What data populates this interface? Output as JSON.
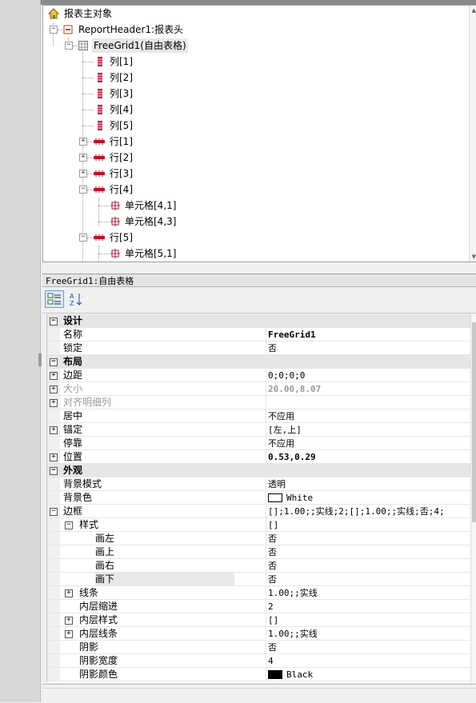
{
  "tree": {
    "root_label": "报表主对象",
    "header_label": "ReportHeader1:报表头",
    "grid_label": "FreeGrid1(自由表格)",
    "columns": [
      "列[1]",
      "列[2]",
      "列[3]",
      "列[4]",
      "列[5]"
    ],
    "rows_collapsed": [
      "行[1]",
      "行[2]",
      "行[3]"
    ],
    "row4_label": "行[4]",
    "row4_cells": [
      "单元格[4,1]",
      "单元格[4,3]"
    ],
    "row5_label": "行[5]",
    "row5_cells": [
      "单元格[5,1]"
    ]
  },
  "props": {
    "object_title": "FreeGrid1:自由表格",
    "toolbar": {
      "categorized_icon": "categorized-icon",
      "alpha_icon": "alphabetical-sort-icon"
    },
    "categories": {
      "design": "设计",
      "layout": "布局",
      "appearance": "外观"
    },
    "rows": {
      "name_label": "名称",
      "name_value": "FreeGrid1",
      "locked_label": "锁定",
      "locked_value": "否",
      "margin_label": "边距",
      "margin_value": "0;0;0;0",
      "size_label": "大小",
      "size_value": "20.00,8.07",
      "align_label": "对齐明细列",
      "align_value": "",
      "center_label": "居中",
      "center_value": "不应用",
      "anchor_label": "锚定",
      "anchor_value": "[左,上]",
      "dock_label": "停靠",
      "dock_value": "不应用",
      "position_label": "位置",
      "position_value": "0.53,0.29",
      "bgmode_label": "背景模式",
      "bgmode_value": "透明",
      "bgcolor_label": "背景色",
      "bgcolor_value": "White",
      "border_label": "边框",
      "border_value": "[];1.00;;实线;2;[];1.00;;实线;否;4;",
      "style_label": "样式",
      "style_value": "[]",
      "left_label": "画左",
      "left_value": "否",
      "top_label": "画上",
      "top_value": "否",
      "right_label": "画右",
      "right_value": "否",
      "bottom_label": "画下",
      "bottom_value": "否",
      "line_label": "线条",
      "line_value": "1.00;;实线",
      "indent_label": "内层缩进",
      "indent_value": "2",
      "innerstyle_label": "内层样式",
      "innerstyle_value": "[]",
      "innerline_label": "内层线条",
      "innerline_value": "1.00;;实线",
      "shadow_label": "阴影",
      "shadow_value": "否",
      "shadowwidth_label": "阴影宽度",
      "shadowwidth_value": "4",
      "shadowcolor_label": "阴影颜色",
      "shadowcolor_value": "Black"
    }
  },
  "colors": {
    "white_swatch": "#ffffff",
    "black_swatch": "#000000",
    "column_icon": "#c0142a",
    "row_icon": "#c0142a",
    "header_icon": "#d0402a"
  }
}
